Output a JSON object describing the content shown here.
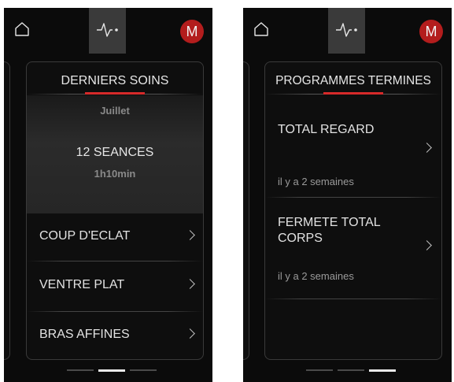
{
  "screen1": {
    "avatar_letter": "M",
    "card_title": "DERNIERS SOINS",
    "month": "Juillet",
    "sessions": "12 SEANCES",
    "duration": "1h10min",
    "items": [
      {
        "label": "COUP D'ECLAT"
      },
      {
        "label": "VENTRE PLAT"
      },
      {
        "label": "BRAS AFFINES"
      }
    ],
    "page_indicator": {
      "count": 3,
      "active": 1
    }
  },
  "screen2": {
    "avatar_letter": "M",
    "card_title": "PROGRAMMES TERMINES",
    "programs": [
      {
        "name": "TOTAL REGARD",
        "when": "il y a 2 semaines"
      },
      {
        "name": "FERMETE TOTAL CORPS",
        "when": "il y a 2 semaines"
      }
    ],
    "page_indicator": {
      "count": 3,
      "active": 2
    }
  },
  "colors": {
    "accent": "#d62a2a",
    "avatar": "#b31d1d",
    "background": "#0b0b0b",
    "active_tab": "#3a3a3a"
  },
  "icons": [
    "home-icon",
    "pulse-icon",
    "chevron-right-icon"
  ]
}
